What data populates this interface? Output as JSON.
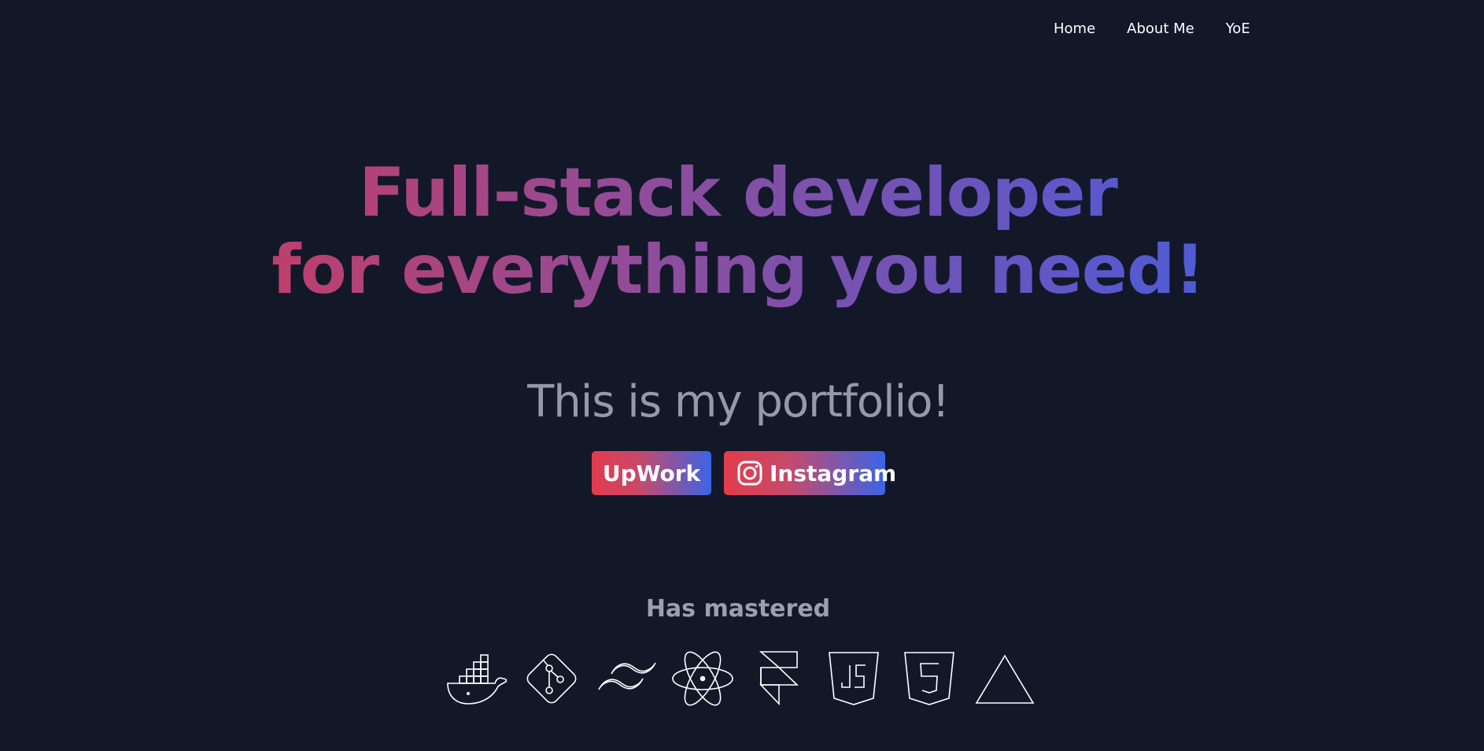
{
  "nav": {
    "items": [
      {
        "label": "Home"
      },
      {
        "label": "About Me"
      },
      {
        "label": "YoE"
      }
    ]
  },
  "hero": {
    "title_line1": "Full-stack developer",
    "title_line2": "for everything you need!",
    "subtitle": "This is my portfolio!"
  },
  "buttons": {
    "upwork_label": "UpWork",
    "instagram_label": "Instagram",
    "instagram_icon": "instagram-icon"
  },
  "mastered": {
    "title": "Has mastered",
    "icons": [
      "docker-icon",
      "git-icon",
      "tailwind-icon",
      "react-icon",
      "framer-icon",
      "javascript-icon",
      "html5-icon",
      "vercel-icon"
    ]
  },
  "colors": {
    "background": "#131829",
    "title_gradient_start": "#be3f6c",
    "title_gradient_end": "#4f5bd6",
    "button_gradient_start": "#e33b4c",
    "button_gradient_end": "#3b64e6",
    "subtitle": "#949aaa"
  }
}
